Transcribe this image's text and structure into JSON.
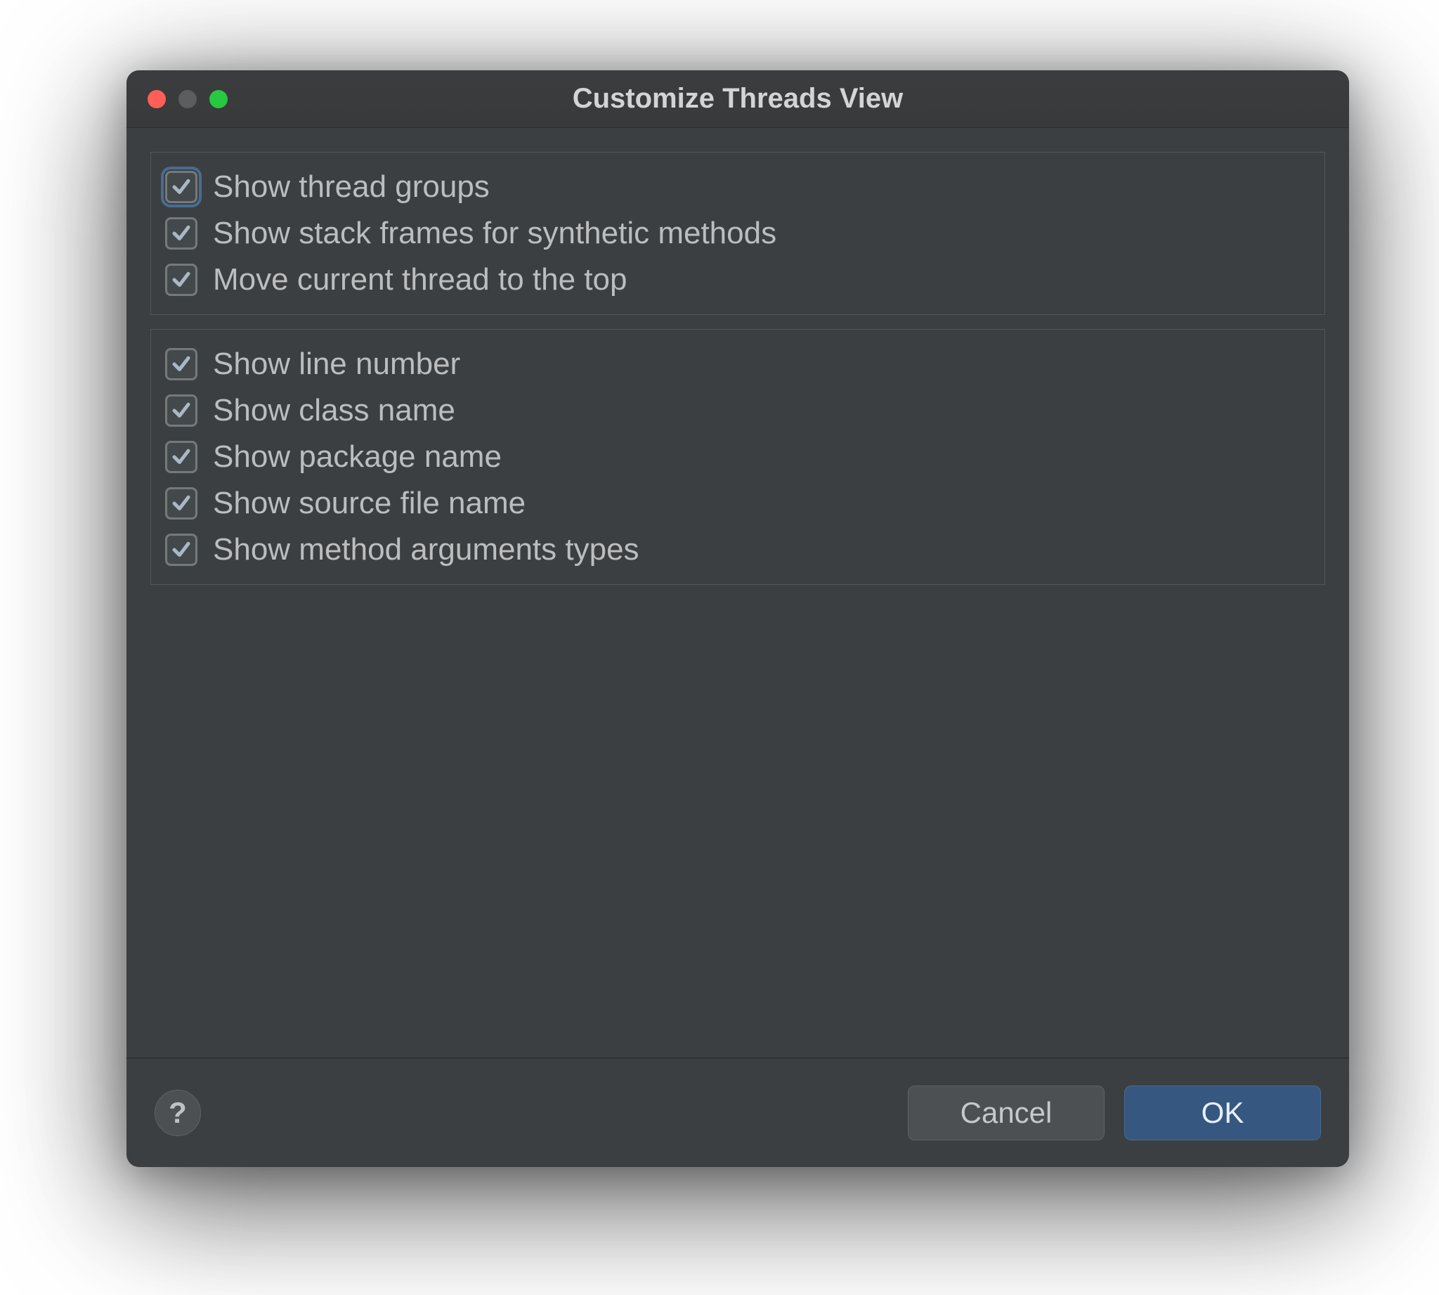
{
  "dialog": {
    "title": "Customize Threads View",
    "groups": [
      {
        "options": [
          {
            "label": "Show thread groups",
            "checked": true,
            "focused": true
          },
          {
            "label": "Show stack frames for synthetic methods",
            "checked": true,
            "focused": false
          },
          {
            "label": "Move current thread to the top",
            "checked": true,
            "focused": false
          }
        ]
      },
      {
        "options": [
          {
            "label": "Show line number",
            "checked": true,
            "focused": false
          },
          {
            "label": "Show class name",
            "checked": true,
            "focused": false
          },
          {
            "label": "Show package name",
            "checked": true,
            "focused": false
          },
          {
            "label": "Show source file name",
            "checked": true,
            "focused": false
          },
          {
            "label": "Show method arguments types",
            "checked": true,
            "focused": false
          }
        ]
      }
    ],
    "buttons": {
      "help": "?",
      "cancel": "Cancel",
      "ok": "OK"
    }
  }
}
